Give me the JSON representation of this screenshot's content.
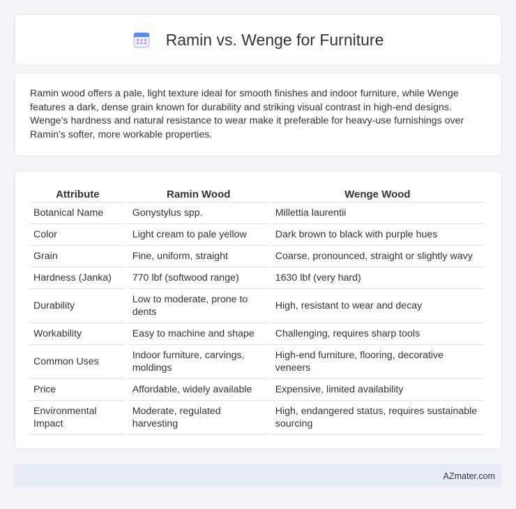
{
  "header": {
    "title": "Ramin vs. Wenge for Furniture",
    "icon": "calendar-icon"
  },
  "intro": {
    "text": "Ramin wood offers a pale, light texture ideal for smooth finishes and indoor furniture, while Wenge features a dark, dense grain known for durability and striking visual contrast in high-end designs. Wenge's hardness and natural resistance to wear make it preferable for heavy-use furnishings over Ramin's softer, more workable properties."
  },
  "table": {
    "headers": [
      "Attribute",
      "Ramin Wood",
      "Wenge Wood"
    ],
    "rows": [
      [
        "Botanical Name",
        "Gonystylus spp.",
        "Millettia laurentii"
      ],
      [
        "Color",
        "Light cream to pale yellow",
        "Dark brown to black with purple hues"
      ],
      [
        "Grain",
        "Fine, uniform, straight",
        "Coarse, pronounced, straight or slightly wavy"
      ],
      [
        "Hardness (Janka)",
        "770 lbf (softwood range)",
        "1630 lbf (very hard)"
      ],
      [
        "Durability",
        "Low to moderate, prone to dents",
        "High, resistant to wear and decay"
      ],
      [
        "Workability",
        "Easy to machine and shape",
        "Challenging, requires sharp tools"
      ],
      [
        "Common Uses",
        "Indoor furniture, carvings, moldings",
        "High-end furniture, flooring, decorative veneers"
      ],
      [
        "Price",
        "Affordable, widely available",
        "Expensive, limited availability"
      ],
      [
        "Environmental Impact",
        "Moderate, regulated harvesting",
        "High, endangered status, requires sustainable sourcing"
      ]
    ]
  },
  "footer": {
    "text": "AZmater.com"
  }
}
